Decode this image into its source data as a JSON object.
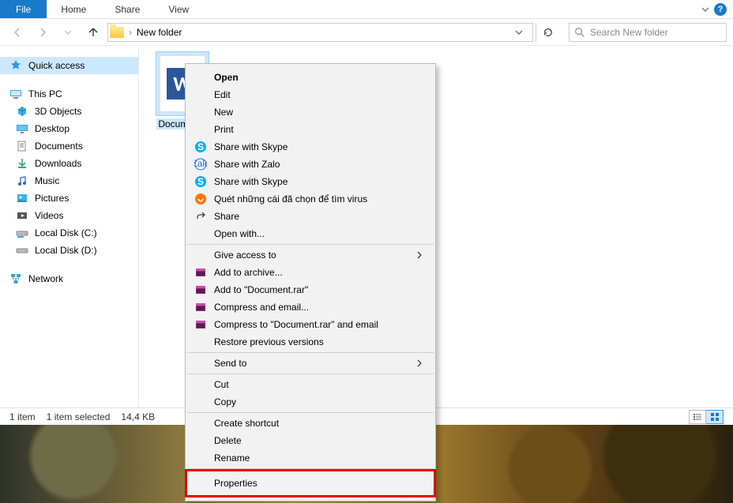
{
  "ribbon": {
    "file": "File",
    "home": "Home",
    "share": "Share",
    "view": "View"
  },
  "nav": {
    "breadcrumb_sep": "›",
    "folder_name": "New folder"
  },
  "search": {
    "placeholder": "Search New folder"
  },
  "sidebar": {
    "quick_access": "Quick access",
    "this_pc": "This PC",
    "items": [
      {
        "label": "3D Objects"
      },
      {
        "label": "Desktop"
      },
      {
        "label": "Documents"
      },
      {
        "label": "Downloads"
      },
      {
        "label": "Music"
      },
      {
        "label": "Pictures"
      },
      {
        "label": "Videos"
      },
      {
        "label": "Local Disk (C:)"
      },
      {
        "label": "Local Disk (D:)"
      }
    ],
    "network": "Network"
  },
  "file": {
    "name": "Documen...",
    "full_name": "Document"
  },
  "statusbar": {
    "count": "1 item",
    "selected": "1 item selected",
    "size": "14,4 KB"
  },
  "context_menu": {
    "open": "Open",
    "edit": "Edit",
    "new": "New",
    "print": "Print",
    "share_skype": "Share with Skype",
    "share_zalo": "Share with Zalo",
    "share_skype2": "Share with Skype",
    "avast_scan": "Quét những cái đã chọn để tìm virus",
    "share": "Share",
    "open_with": "Open with...",
    "give_access": "Give access to",
    "add_archive": "Add to archive...",
    "add_doc_rar": "Add to \"Document.rar\"",
    "compress_email": "Compress and email...",
    "compress_doc_email": "Compress to \"Document.rar\" and email",
    "restore": "Restore previous versions",
    "send_to": "Send to",
    "cut": "Cut",
    "copy": "Copy",
    "create_shortcut": "Create shortcut",
    "delete": "Delete",
    "rename": "Rename",
    "properties": "Properties"
  }
}
